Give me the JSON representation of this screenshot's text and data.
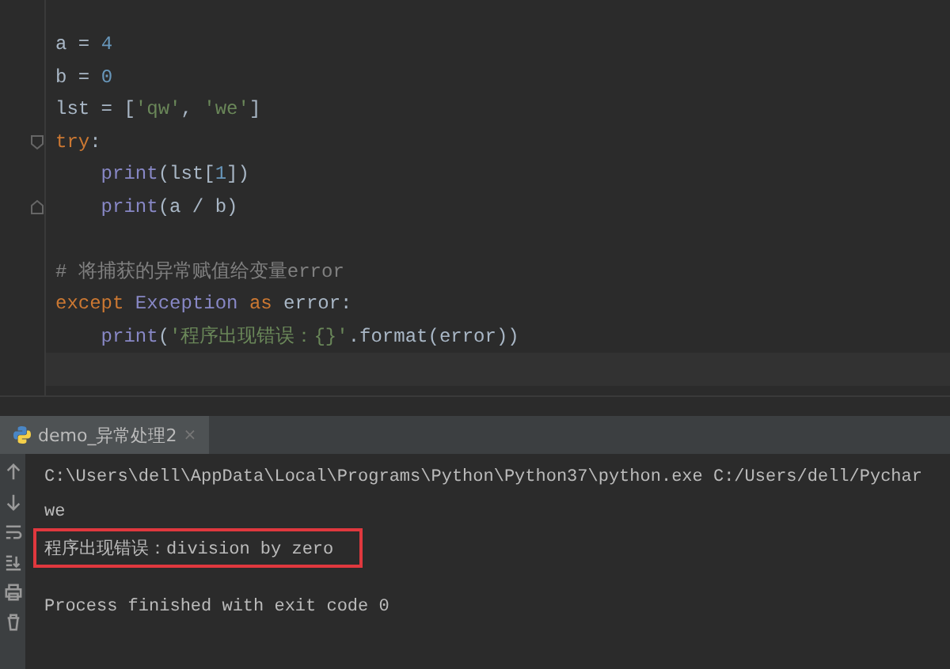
{
  "editor": {
    "lines": [
      {
        "kind": "code",
        "tokens": [
          {
            "text": "a = ",
            "kind": "plain"
          },
          {
            "text": "4",
            "kind": "number"
          }
        ]
      },
      {
        "kind": "code",
        "tokens": [
          {
            "text": "b = ",
            "kind": "plain"
          },
          {
            "text": "0",
            "kind": "number"
          }
        ]
      },
      {
        "kind": "code",
        "tokens": [
          {
            "text": "lst = [",
            "kind": "plain"
          },
          {
            "text": "'qw'",
            "kind": "string"
          },
          {
            "text": ", ",
            "kind": "plain"
          },
          {
            "text": "'we'",
            "kind": "string"
          },
          {
            "text": "]",
            "kind": "plain"
          }
        ]
      },
      {
        "kind": "code",
        "fold_start": true,
        "tokens": [
          {
            "text": "try",
            "kind": "keyword"
          },
          {
            "text": ":",
            "kind": "plain"
          }
        ]
      },
      {
        "kind": "code",
        "tokens": [
          {
            "text": "    print",
            "kind": "builtin"
          },
          {
            "text": "(lst[",
            "kind": "plain"
          },
          {
            "text": "1",
            "kind": "number"
          },
          {
            "text": "])",
            "kind": "plain"
          }
        ]
      },
      {
        "kind": "code",
        "fold_end": true,
        "tokens": [
          {
            "text": "    print",
            "kind": "builtin"
          },
          {
            "text": "(a / b)",
            "kind": "plain"
          }
        ]
      },
      {
        "kind": "blank"
      },
      {
        "kind": "code",
        "tokens": [
          {
            "text": "# 将捕获的异常赋值给变量error",
            "kind": "comment"
          }
        ]
      },
      {
        "kind": "code",
        "tokens": [
          {
            "text": "except ",
            "kind": "keyword"
          },
          {
            "text": "Exception ",
            "kind": "builtin"
          },
          {
            "text": "as ",
            "kind": "keyword"
          },
          {
            "text": "error:",
            "kind": "plain"
          }
        ]
      },
      {
        "kind": "code",
        "tokens": [
          {
            "text": "    print",
            "kind": "builtin"
          },
          {
            "text": "(",
            "kind": "plain"
          },
          {
            "text": "'程序出现错误：{}'",
            "kind": "string"
          },
          {
            "text": ".format(error))",
            "kind": "plain"
          }
        ]
      },
      {
        "kind": "current"
      }
    ]
  },
  "run_panel": {
    "tab": {
      "label": "demo_异常处理2",
      "close": "×",
      "selected": true
    },
    "output": [
      {
        "text": "C:\\Users\\dell\\AppData\\Local\\Programs\\Python\\Python37\\python.exe C:/Users/dell/Pychar",
        "highlighted": false
      },
      {
        "text": "we",
        "highlighted": false
      },
      {
        "text": "程序出现错误：division by zero",
        "highlighted": true
      },
      {
        "text": "Process finished with exit code 0",
        "highlighted": false
      }
    ]
  }
}
